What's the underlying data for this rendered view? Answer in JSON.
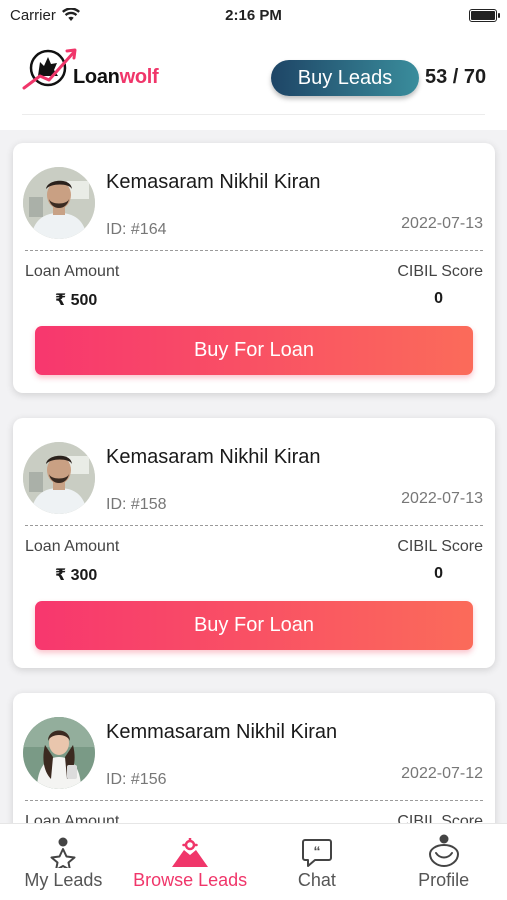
{
  "status_bar": {
    "carrier": "Carrier",
    "time": "2:16 PM"
  },
  "header": {
    "logo_text_part1": "Loan",
    "logo_text_part2": "wolf",
    "buy_leads_label": "Buy Leads",
    "lead_count": "53 / 70"
  },
  "colors": {
    "brand_pink": "#f0366a",
    "buy_leads_start": "#1e4566",
    "buy_leads_end": "#3a8d9c"
  },
  "leads": [
    {
      "name": "Kemasaram Nikhil Kiran",
      "id": "ID: #164",
      "date": "2022-07-13",
      "loan_label": "Loan Amount",
      "loan_amount": "₹ 500",
      "cibil_label": "CIBIL Score",
      "cibil_score": "0",
      "button": "Buy For Loan"
    },
    {
      "name": "Kemasaram Nikhil Kiran",
      "id": "ID: #158",
      "date": "2022-07-13",
      "loan_label": "Loan Amount",
      "loan_amount": "₹ 300",
      "cibil_label": "CIBIL Score",
      "cibil_score": "0",
      "button": "Buy For Loan"
    },
    {
      "name": "Kemmasaram Nikhil Kiran",
      "id": "ID: #156",
      "date": "2022-07-12",
      "loan_label": "Loan Amount",
      "loan_amount": "",
      "cibil_label": "CIBIL Score",
      "cibil_score": "",
      "button": ""
    }
  ],
  "tabs": [
    {
      "label": "My Leads",
      "icon": "my-leads-icon",
      "active": false
    },
    {
      "label": "Browse Leads",
      "icon": "browse-leads-icon",
      "active": true
    },
    {
      "label": "Chat",
      "icon": "chat-icon",
      "active": false
    },
    {
      "label": "Profile",
      "icon": "profile-icon",
      "active": false
    }
  ]
}
